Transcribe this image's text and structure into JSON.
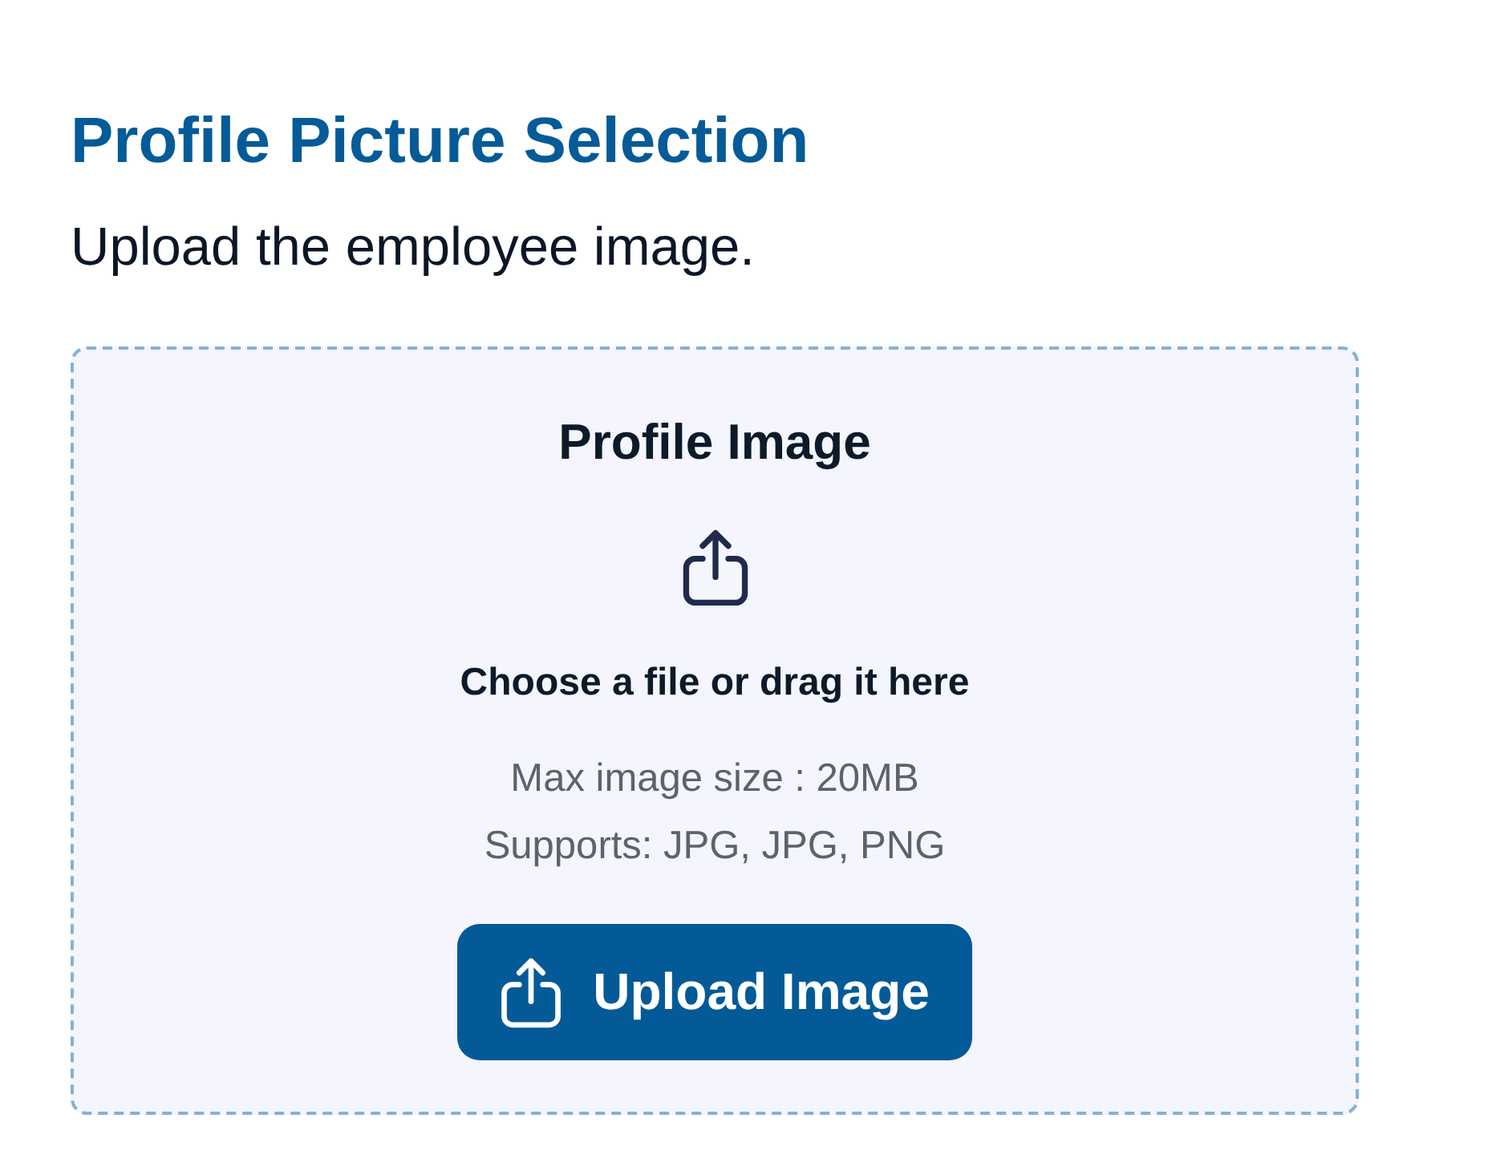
{
  "header": {
    "title": "Profile Picture Selection",
    "subtitle": "Upload the employee image."
  },
  "upload_area": {
    "title": "Profile Image",
    "prompt": "Choose a file or drag it here",
    "notes": [
      "Max image size : 20MB",
      "Supports: JPG, JPG, PNG"
    ],
    "button": {
      "label": "Upload Image"
    }
  }
}
